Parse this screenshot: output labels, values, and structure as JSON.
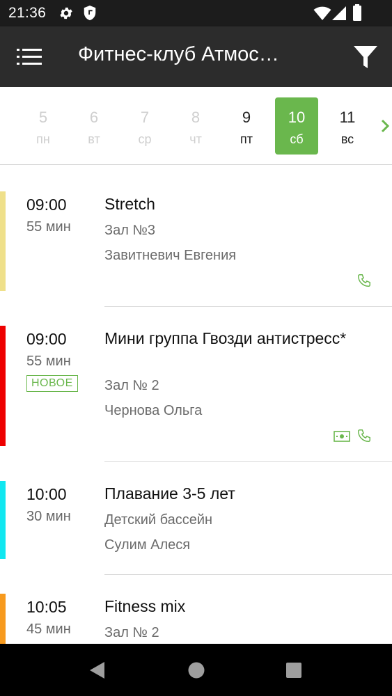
{
  "status": {
    "time": "21:36"
  },
  "header": {
    "title": "Фитнес-клуб Атмос…"
  },
  "icons": {
    "menu": "hamburger-menu-icon",
    "filter": "filter-funnel-icon",
    "next": "chevron-right-icon",
    "phone": "phone-icon",
    "money": "banknote-icon"
  },
  "colors": {
    "accent": "#6ab74d",
    "appbar": "#2c2c2c",
    "statusbar": "#1c1c1c"
  },
  "days": [
    {
      "num": "5",
      "name": "пн",
      "state": "disabled"
    },
    {
      "num": "6",
      "name": "вт",
      "state": "disabled"
    },
    {
      "num": "7",
      "name": "ср",
      "state": "disabled"
    },
    {
      "num": "8",
      "name": "чт",
      "state": "disabled"
    },
    {
      "num": "9",
      "name": "пт",
      "state": "active"
    },
    {
      "num": "10",
      "name": "сб",
      "state": "selected"
    },
    {
      "num": "11",
      "name": "вс",
      "state": "active"
    }
  ],
  "classes": [
    {
      "time": "09:00",
      "duration": "55 мин",
      "badge": "",
      "title": "Stretch",
      "hall": "Зал №3",
      "trainer": "Завитневич Евгения",
      "color": "#efe08a",
      "icons": [
        "phone"
      ]
    },
    {
      "time": "09:00",
      "duration": "55 мин",
      "badge": "НОВОЕ",
      "title": "Мини группа Гвозди антистресс*",
      "hall": "Зал № 2",
      "trainer": "Чернова Ольга",
      "color": "#ee0000",
      "icons": [
        "money",
        "phone"
      ]
    },
    {
      "time": "10:00",
      "duration": "30 мин",
      "badge": "",
      "title": "Плавание 3-5 лет",
      "hall": "Детский бассейн",
      "trainer": "Сулим Алеся",
      "color": "#11e7f0",
      "icons": []
    },
    {
      "time": "10:05",
      "duration": "45 мин",
      "badge": "",
      "title": "Fitness mix",
      "hall": "Зал № 2",
      "trainer": "",
      "color": "#f79a1e",
      "icons": []
    }
  ]
}
